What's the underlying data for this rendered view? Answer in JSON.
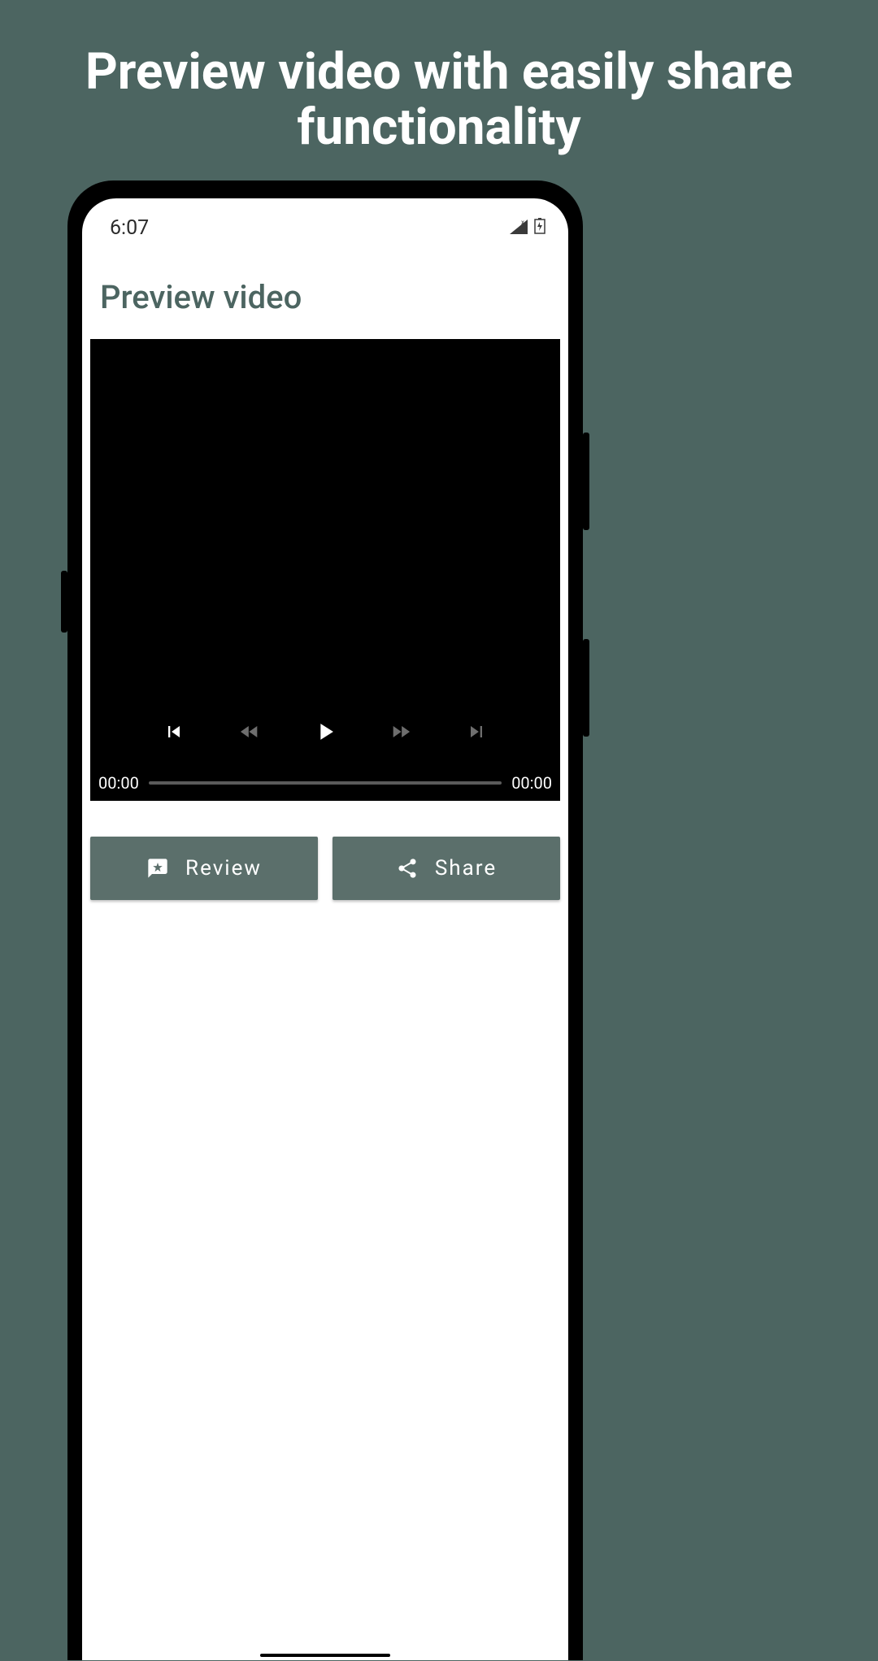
{
  "promo": {
    "title": "Preview video with easily share functionality"
  },
  "statusBar": {
    "time": "6:07"
  },
  "page": {
    "title": "Preview video"
  },
  "video": {
    "currentTime": "00:00",
    "duration": "00:00"
  },
  "actions": {
    "reviewLabel": "Review",
    "shareLabel": "Share"
  }
}
